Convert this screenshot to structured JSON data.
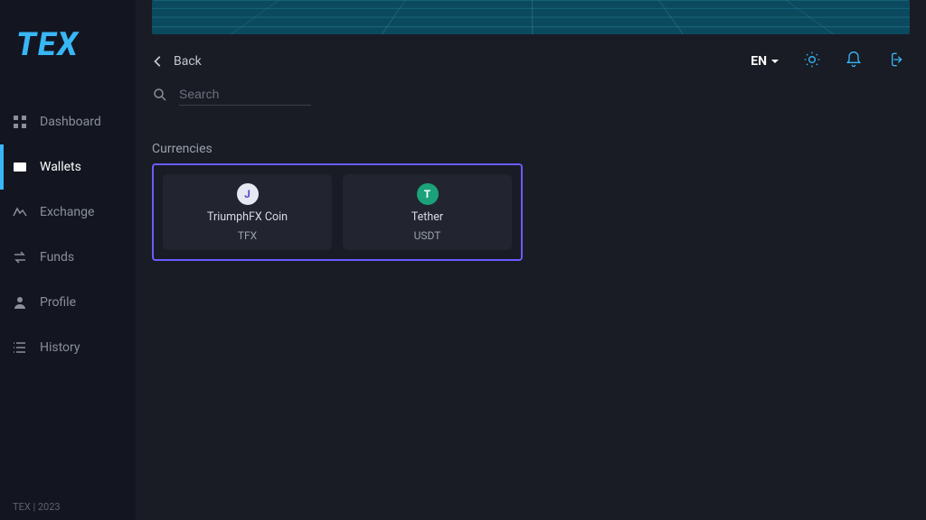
{
  "brand": "TEX",
  "footer": "TEX | 2023",
  "nav": {
    "dashboard": "Dashboard",
    "wallets": "Wallets",
    "exchange": "Exchange",
    "funds": "Funds",
    "profile": "Profile",
    "history": "History"
  },
  "topbar": {
    "back": "Back",
    "lang": "EN"
  },
  "search": {
    "placeholder": "Search"
  },
  "section": {
    "title": "Currencies"
  },
  "currencies": [
    {
      "name": "TriumphFX Coin",
      "symbol": "TFX",
      "badge": "J",
      "accent": "#5a47c8",
      "bg": "#e6e8f2"
    },
    {
      "name": "Tether",
      "symbol": "USDT",
      "badge": "T",
      "accent": "#ffffff",
      "bg": "#1ba27a"
    }
  ]
}
